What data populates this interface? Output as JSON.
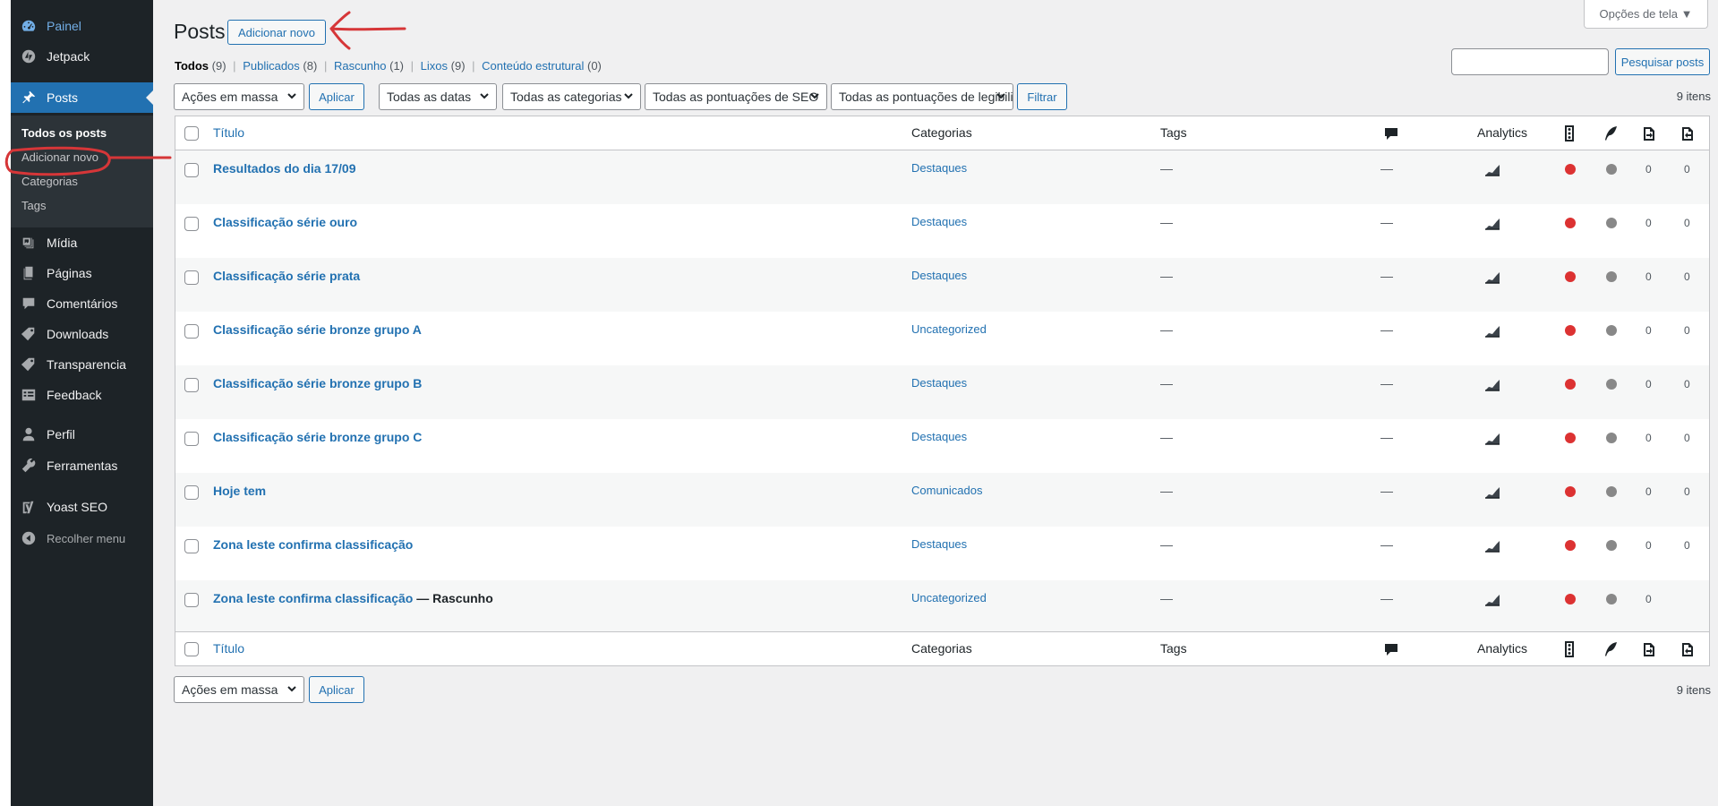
{
  "sidebar": {
    "items": [
      {
        "label": "Painel",
        "icon": "dashboard-icon"
      },
      {
        "label": "Jetpack",
        "icon": "jetpack-icon"
      },
      {
        "label": "Posts",
        "icon": "pin-icon"
      },
      {
        "label": "Mídia",
        "icon": "media-icon"
      },
      {
        "label": "Páginas",
        "icon": "pages-icon"
      },
      {
        "label": "Comentários",
        "icon": "comments-icon"
      },
      {
        "label": "Downloads",
        "icon": "tag-icon"
      },
      {
        "label": "Transparencia",
        "icon": "tag-icon"
      },
      {
        "label": "Feedback",
        "icon": "feedback-icon"
      },
      {
        "label": "Perfil",
        "icon": "user-icon"
      },
      {
        "label": "Ferramentas",
        "icon": "wrench-icon"
      },
      {
        "label": "Yoast SEO",
        "icon": "yoast-icon"
      },
      {
        "label": "Recolher menu",
        "icon": "collapse-icon"
      }
    ],
    "submenu": [
      "Todos os posts",
      "Adicionar novo",
      "Categorias",
      "Tags"
    ]
  },
  "header": {
    "title": "Posts",
    "add_new": "Adicionar novo",
    "screen_options": "Opções de tela ▼"
  },
  "views": [
    {
      "label": "Todos",
      "count": "(9)"
    },
    {
      "label": "Publicados",
      "count": "(8)"
    },
    {
      "label": "Rascunho",
      "count": "(1)"
    },
    {
      "label": "Lixos",
      "count": "(9)"
    },
    {
      "label": "Conteúdo estrutural",
      "count": "(0)"
    }
  ],
  "search": {
    "button": "Pesquisar posts",
    "value": ""
  },
  "filters": {
    "bulk": "Ações em massa",
    "apply": "Aplicar",
    "dates": "Todas as datas",
    "categories": "Todas as categorias",
    "seo": "Todas as pontuações de SEO",
    "readability": "Todas as pontuações de legibilidade",
    "filter": "Filtrar",
    "count": "9 itens"
  },
  "columns": {
    "title": "Título",
    "categories": "Categorias",
    "tags": "Tags",
    "analytics": "Analytics",
    "comments_icon": "comment-bubble-icon",
    "seo_icon": "traffic-light-icon",
    "readability_icon": "quill-icon",
    "links_out_icon": "outgoing-links-icon",
    "links_in_icon": "incoming-links-icon"
  },
  "rows": [
    {
      "title": "Resultados do dia 17/09",
      "state": "",
      "category": "Destaques",
      "tags": "—",
      "comments": "—",
      "seo": "#dc3232",
      "readability": "#888888",
      "links_out": "0",
      "links_in": "0"
    },
    {
      "title": "Classificação série ouro",
      "state": "",
      "category": "Destaques",
      "tags": "—",
      "comments": "—",
      "seo": "#dc3232",
      "readability": "#888888",
      "links_out": "0",
      "links_in": "0"
    },
    {
      "title": "Classificação série prata",
      "state": "",
      "category": "Destaques",
      "tags": "—",
      "comments": "—",
      "seo": "#dc3232",
      "readability": "#888888",
      "links_out": "0",
      "links_in": "0"
    },
    {
      "title": "Classificação série bronze grupo A",
      "state": "",
      "category": "Uncategorized",
      "tags": "—",
      "comments": "—",
      "seo": "#dc3232",
      "readability": "#888888",
      "links_out": "0",
      "links_in": "0"
    },
    {
      "title": "Classificação série bronze grupo B",
      "state": "",
      "category": "Destaques",
      "tags": "—",
      "comments": "—",
      "seo": "#dc3232",
      "readability": "#888888",
      "links_out": "0",
      "links_in": "0"
    },
    {
      "title": "Classificação série bronze grupo C",
      "state": "",
      "category": "Destaques",
      "tags": "—",
      "comments": "—",
      "seo": "#dc3232",
      "readability": "#888888",
      "links_out": "0",
      "links_in": "0"
    },
    {
      "title": "Hoje tem",
      "state": "",
      "category": "Comunicados",
      "tags": "—",
      "comments": "—",
      "seo": "#dc3232",
      "readability": "#888888",
      "links_out": "0",
      "links_in": "0"
    },
    {
      "title": "Zona leste confirma classificação",
      "state": "",
      "category": "Destaques",
      "tags": "—",
      "comments": "—",
      "seo": "#dc3232",
      "readability": "#888888",
      "links_out": "0",
      "links_in": "0"
    },
    {
      "title": "Zona leste confirma classificação",
      "state": " — Rascunho",
      "category": "Uncategorized",
      "tags": "—",
      "comments": "—",
      "seo": "#dc3232",
      "readability": "#888888",
      "links_out": "0",
      "links_in": ""
    }
  ],
  "colors": {
    "accent": "#2271b1",
    "sidebar": "#1d2327",
    "annotation": "#d63638"
  }
}
